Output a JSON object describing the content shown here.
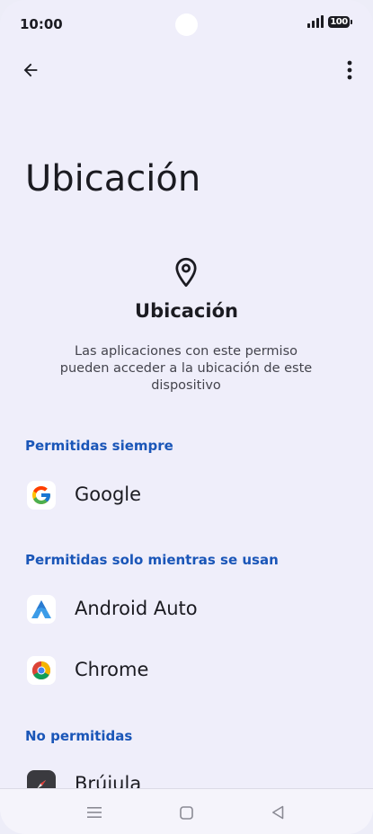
{
  "status_bar": {
    "time": "10:00",
    "battery_level": "100"
  },
  "page": {
    "title": "Ubicación"
  },
  "permission_header": {
    "icon": "location-pin-icon",
    "title": "Ubicación",
    "description": "Las aplicaciones con este permiso pueden acceder a la ubicación de este dispositivo"
  },
  "sections": {
    "always": {
      "label": "Permitidas siempre",
      "apps": [
        {
          "name": "Google",
          "icon": "google-icon"
        }
      ]
    },
    "while_in_use": {
      "label": "Permitidas solo mientras se usan",
      "apps": [
        {
          "name": "Android Auto",
          "icon": "android-auto-icon"
        },
        {
          "name": "Chrome",
          "icon": "chrome-icon"
        }
      ]
    },
    "denied": {
      "label": "No permitidas",
      "apps": [
        {
          "name": "Brújula",
          "icon": "compass-icon"
        }
      ]
    }
  },
  "colors": {
    "background": "#efeefa",
    "accent": "#1a56b8",
    "text_primary": "#1b1b21",
    "text_secondary": "#44444d"
  }
}
